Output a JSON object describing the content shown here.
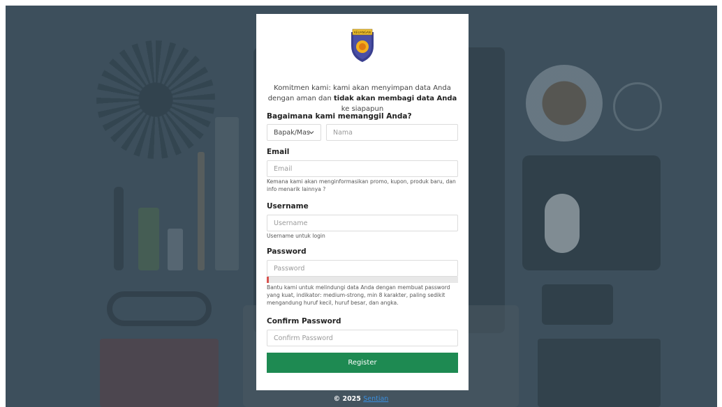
{
  "intro": {
    "part1": "Komitmen kami: kami akan menyimpan data Anda dengan aman dan ",
    "bold": "tidak akan membagi data Anda",
    "part2": " ke siapapun"
  },
  "name_section": {
    "label": "Bagaimana kami memanggil Anda?",
    "salutation_selected": "Bapak/Mas",
    "name_placeholder": "Nama"
  },
  "email_section": {
    "label": "Email",
    "placeholder": "Email",
    "hint": "Kemana kami akan menginformasikan promo, kupon, produk baru, dan info menarik lainnya ?"
  },
  "username_section": {
    "label": "Username",
    "placeholder": "Username",
    "hint": "Username untuk login"
  },
  "password_section": {
    "label": "Password",
    "placeholder": "Password",
    "strength_fraction": 0.01,
    "hint": "Bantu kami untuk melindungi data Anda dengan membuat password yang kuat, indikator: medium-strong, min 8 karakter, paling sedikit mengandung huruf kecil, huruf besar, dan angka."
  },
  "confirm_section": {
    "label": "Confirm Password",
    "placeholder": "Confirm Password"
  },
  "register_label": "Register",
  "footer": {
    "copyright": "© 2025 ",
    "link": "Sentian"
  },
  "logo": {
    "banner_text": "KEUANGAN",
    "colors": {
      "shield": "#3a3f8f",
      "emblem": "#f2b01e"
    }
  },
  "colors": {
    "primary": "#1e8a52",
    "meter": "#d9534f"
  }
}
